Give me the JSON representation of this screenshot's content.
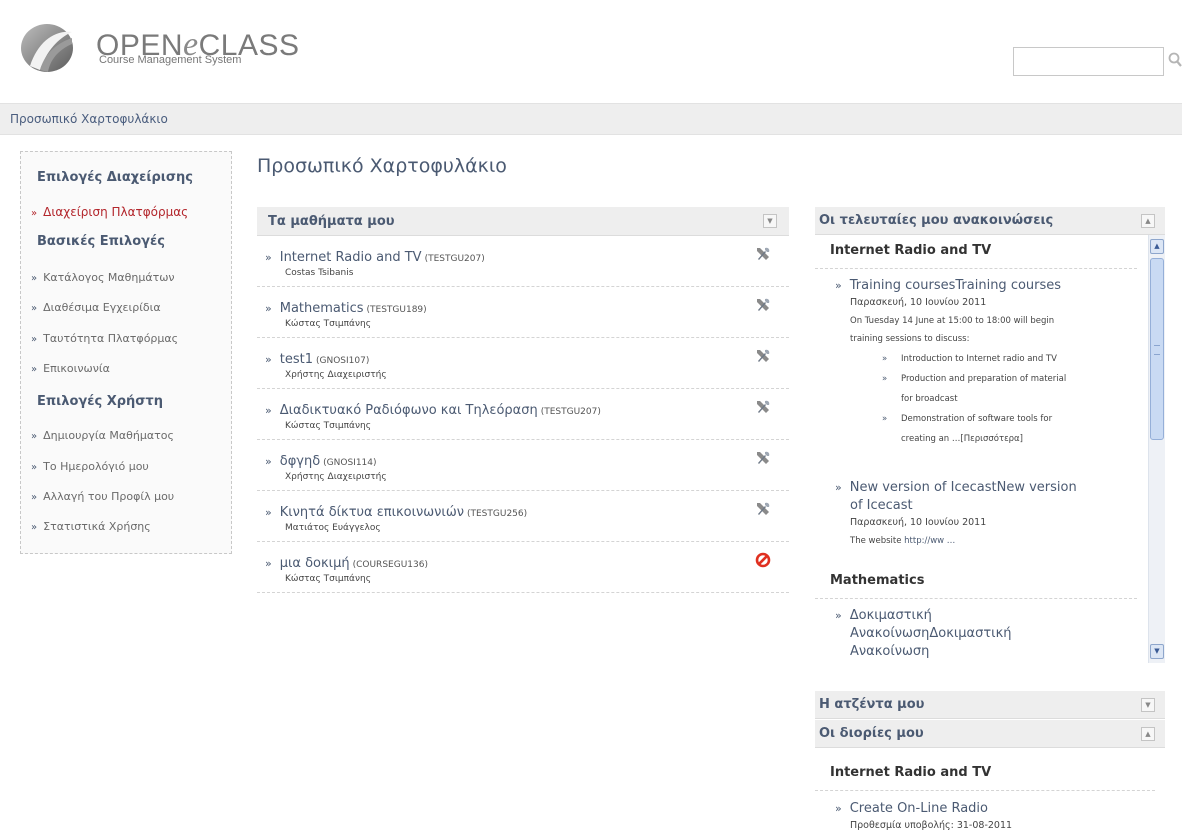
{
  "header": {
    "logo_title_open": "OPEN",
    "logo_title_e": "e",
    "logo_title_class": "CLASS",
    "logo_subtitle": "Course Management System",
    "search_value": ""
  },
  "breadcrumb": "Προσωπικό Χαρτοφυλάκιο",
  "page_title": "Προσωπικό Χαρτοφυλάκιο",
  "sidebar": {
    "sections": [
      {
        "heading": "Επιλογές Διαχείρισης"
      },
      {
        "heading": "Βασικές Επιλογές"
      },
      {
        "heading": "Επιλογές Χρήστη"
      }
    ],
    "items": [
      {
        "label": "Διαχείριση Πλατφόρμας",
        "active": true
      },
      {
        "label": "Κατάλογος Μαθημάτων"
      },
      {
        "label": "Διαθέσιμα Εγχειρίδια"
      },
      {
        "label": "Ταυτότητα Πλατφόρμας"
      },
      {
        "label": "Επικοινωνία"
      },
      {
        "label": "Δημιουργία Μαθήματος"
      },
      {
        "label": "Το Ημερολόγιό μου"
      },
      {
        "label": "Αλλαγή του Προφίλ μου"
      },
      {
        "label": "Στατιστικά Χρήσης"
      }
    ],
    "bullet": "»"
  },
  "courses": {
    "title": "Τα μαθήματα μου",
    "rows": [
      {
        "title": "Internet Radio and TV",
        "code": "(TESTGU207)",
        "professor": "Costas Tsibanis",
        "icon": "tools-icon"
      },
      {
        "title": "Mathematics",
        "code": "(TESTGU189)",
        "professor": "Κώστας Τσιμπάνης",
        "icon": "tools-icon"
      },
      {
        "title": "test1",
        "code": "(GNOSI107)",
        "professor": "Χρήστης Διαχειριστής",
        "icon": "tools-icon"
      },
      {
        "title": "Διαδικτυακό Ραδιόφωνο και Τηλεόραση",
        "code": "(TESTGU207)",
        "professor": "Κώστας Τσιμπάνης",
        "icon": "tools-icon"
      },
      {
        "title": "δφγηδ",
        "code": "(GNOSI114)",
        "professor": "Χρήστης Διαχειριστής",
        "icon": "tools-icon"
      },
      {
        "title": "Κινητά δίκτυα επικοινωνιών",
        "code": "(TESTGU256)",
        "professor": "Ματιάτος Ευάγγελος",
        "icon": "tools-icon"
      },
      {
        "title": "μια δοκιμή",
        "code": "(COURSEGU136)",
        "professor": "Κώστας Τσιμπάνης",
        "icon": "unsubscribe-icon"
      }
    ]
  },
  "announcements": {
    "title": "Οι τελευταίες μου ανακοινώσεις",
    "courses": [
      {
        "name": "Internet Radio and TV",
        "items": [
          {
            "title": "Training coursesTraining courses",
            "date": "Παρασκευή, 10 Ιουνίου 2011",
            "text1": "On Tuesday 14 June at 15:00 to 18:00 will begin",
            "text2": "training sessions to discuss:",
            "bullets": [
              "Introduction to Internet radio and TV",
              "Production and preparation of material",
              "for broadcast",
              "Demonstration of software tools for",
              "creating an …[Περισσότερα]"
            ]
          },
          {
            "title_l1": "New version of IcecastNew version",
            "title_l2": "of Icecast",
            "date": "Παρασκευή, 10 Ιουνίου 2011",
            "text_prefix": "The website ",
            "text_link": "http://ww …"
          }
        ]
      },
      {
        "name": "Mathematics",
        "items": [
          {
            "title_l1": "Δοκιμαστική",
            "title_l2": "ΑνακοίνωσηΔοκιμαστική",
            "title_l3": "Ανακοίνωση"
          }
        ]
      }
    ]
  },
  "agenda": {
    "title": "Η ατζέντα μου"
  },
  "deadlines": {
    "title": "Οι διορίες μου",
    "course": "Internet Radio and TV",
    "item_title": "Create On-Line Radio",
    "item_due": "Προθεσμία υποβολής: 31-08-2011"
  },
  "icons": {
    "collapse_down": "▼",
    "collapse_up": "▲",
    "scroll_up": "▲",
    "scroll_down": "▼",
    "item_bullet": "»"
  },
  "colors": {
    "link": "#4b5a72",
    "active": "#b3262c",
    "panel_header_bg": "#eeeeee",
    "unsubscribe": "#e03020"
  }
}
